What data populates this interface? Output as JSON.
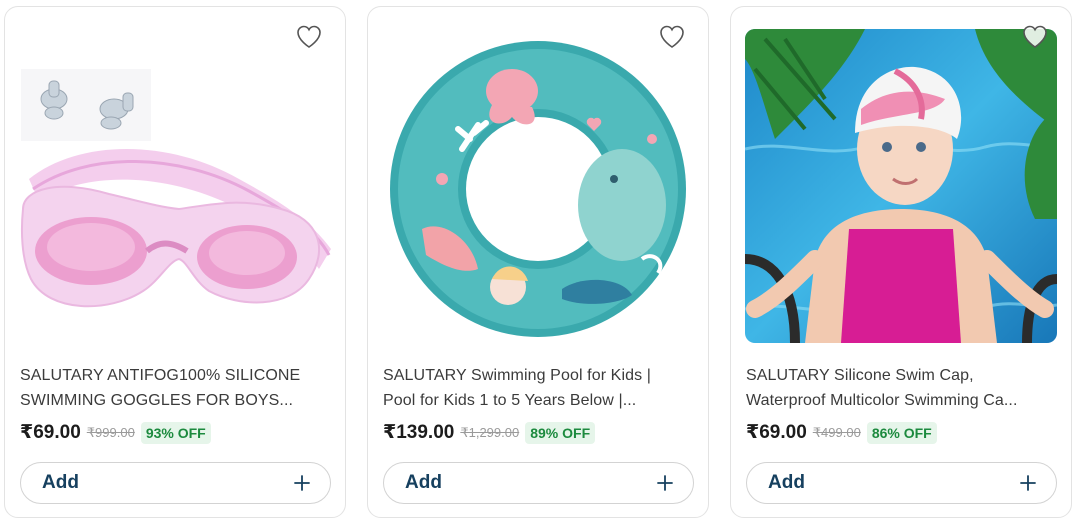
{
  "colors": {
    "accent_button_text": "#16405f",
    "discount_text": "#1c8a3e",
    "discount_bg": "#e6f5ea"
  },
  "products": [
    {
      "image_icon": "swimming-goggles-image",
      "title_line1": "SALUTARY ANTIFOG100% SILICONE",
      "title_line2": "SWIMMING GOGGLES FOR BOYS...",
      "price": "₹69.00",
      "mrp": "₹999.00",
      "discount": "93% OFF",
      "add_label": "Add"
    },
    {
      "image_icon": "swim-ring-image",
      "title_line1": "SALUTARY Swimming Pool for Kids |",
      "title_line2": "Pool for Kids 1 to 5 Years Below |...",
      "price": "₹139.00",
      "mrp": "₹1,299.00",
      "discount": "89% OFF",
      "add_label": "Add"
    },
    {
      "image_icon": "swim-cap-image",
      "title_line1": "SALUTARY Silicone Swim Cap,",
      "title_line2": "Waterproof Multicolor Swimming Ca...",
      "price": "₹69.00",
      "mrp": "₹499.00",
      "discount": "86% OFF",
      "add_label": "Add"
    }
  ]
}
